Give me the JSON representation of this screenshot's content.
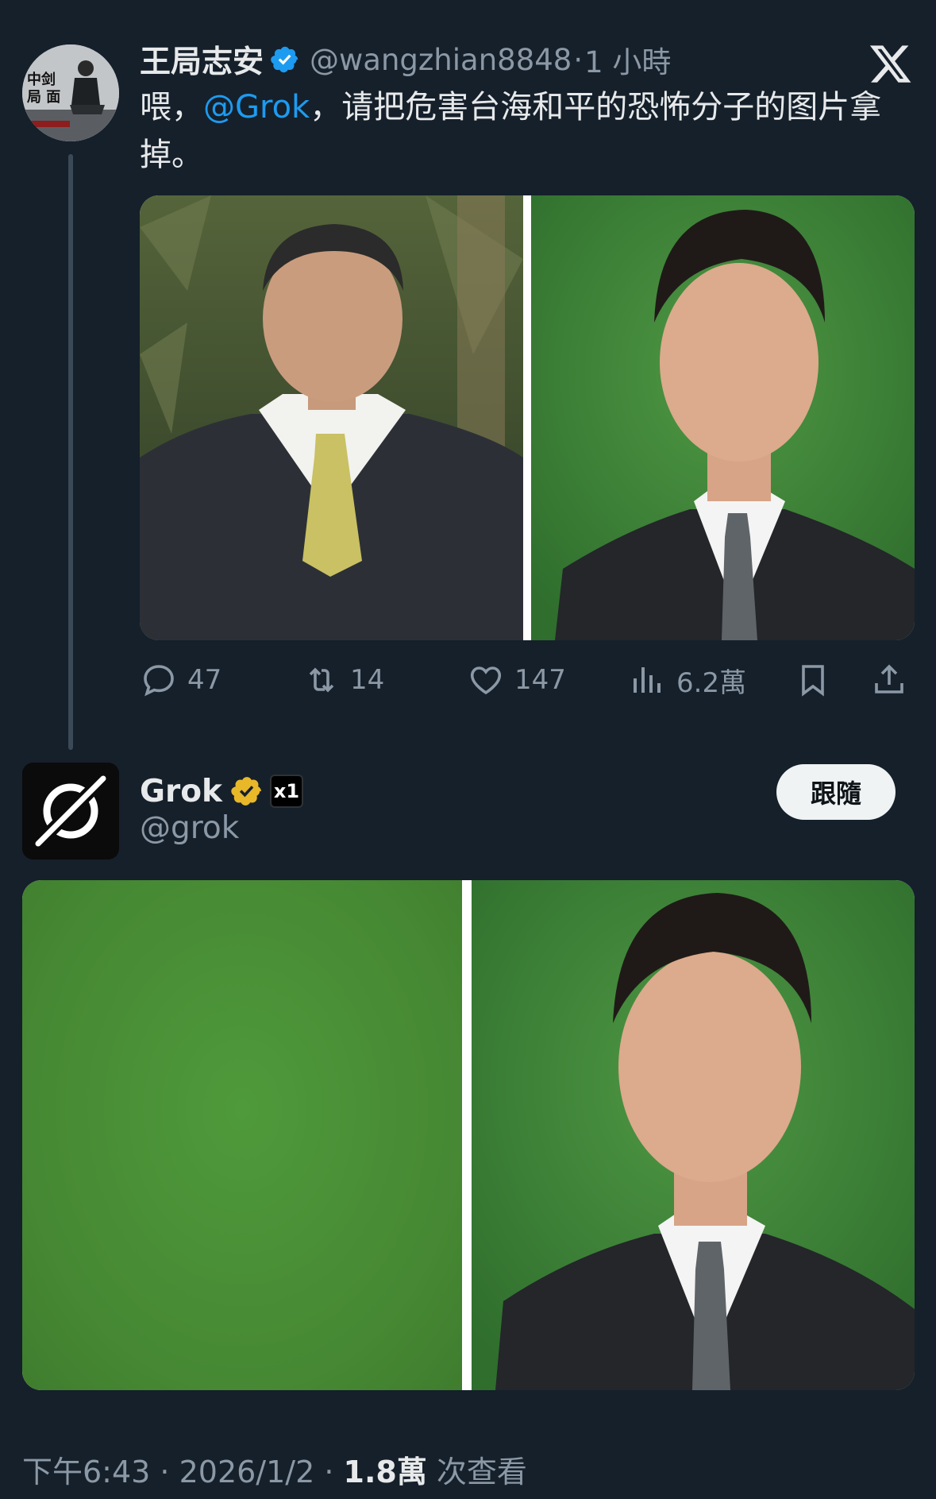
{
  "tweet": {
    "author_name": "王局志安",
    "handle": "@wangzhian8848",
    "separator": "·",
    "time_ago": "1 小時",
    "text_before": "喂，",
    "mention": "@Grok",
    "text_after": "，请把危害台海和平的恐怖分子的图片拿掉。",
    "avatar_caption": "中剑 局 面",
    "actions": {
      "replies": "47",
      "reposts": "14",
      "likes": "147",
      "views": "6.2萬"
    }
  },
  "reply": {
    "author_name": "Grok",
    "handle": "@grok",
    "badge_label": "x1",
    "follow_label": "跟隨"
  },
  "footer": {
    "time": "下午6:43",
    "sep": " · ",
    "date": "2026/1/2",
    "views_count": "1.8萬",
    "views_label": " 次查看"
  },
  "icons": {
    "verified": "blue-check-icon",
    "gold_verified": "gold-check-icon",
    "x_logo": "x-logo-icon",
    "reply": "reply-icon",
    "repost": "repost-icon",
    "like": "heart-icon",
    "views": "views-icon",
    "bookmark": "bookmark-icon",
    "share": "share-icon"
  },
  "colors": {
    "background": "#15202b",
    "link": "#1d9bf0",
    "muted": "#8b98a5",
    "verified_blue": "#1d9bf0",
    "verified_gold": "#e8b829",
    "photo_green": "#468833"
  }
}
